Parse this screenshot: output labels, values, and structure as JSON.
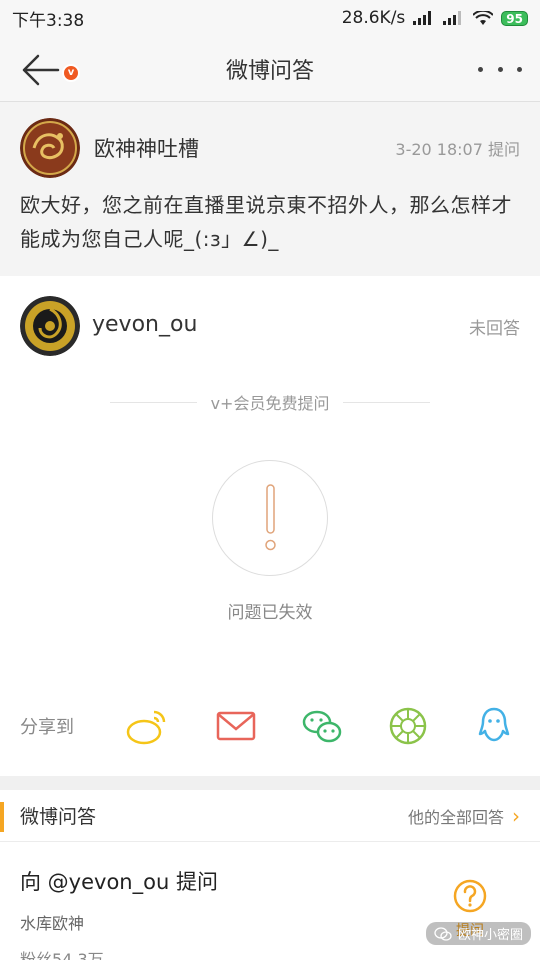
{
  "status_bar": {
    "time": "下午3:38",
    "network_speed": "28.6K/s",
    "battery": "95"
  },
  "nav": {
    "title": "微博问答"
  },
  "question": {
    "asker_name": "欧神神吐槽",
    "time_action": "3-20 18:07 提问",
    "text": "欧大好，您之前在直播里说京東不招外人，那么怎样才能成为您自己人呢_(:з」∠)_"
  },
  "answerer": {
    "name": "yevon_ou",
    "status": "未回答",
    "badge": "v"
  },
  "vip_divider": "v+会员免费提问",
  "invalid_message": "问题已失效",
  "share": {
    "label": "分享到",
    "targets": [
      "weibo-icon",
      "mail-icon",
      "wechat-icon",
      "moments-icon",
      "qq-icon"
    ]
  },
  "card": {
    "title": "微博问答",
    "link": "他的全部回答",
    "ask_title": "向 @yevon_ou 提问",
    "subtitle": "水库欧神",
    "fans": "粉丝54.3万",
    "ask_button": "提问"
  },
  "watermark": "欧神小密圈",
  "colors": {
    "accent": "#f5a623",
    "weibo": "#f5c518",
    "mail": "#e8655a",
    "wechat": "#3db66a",
    "moments": "#8bc34a",
    "qq": "#43b1e6"
  }
}
